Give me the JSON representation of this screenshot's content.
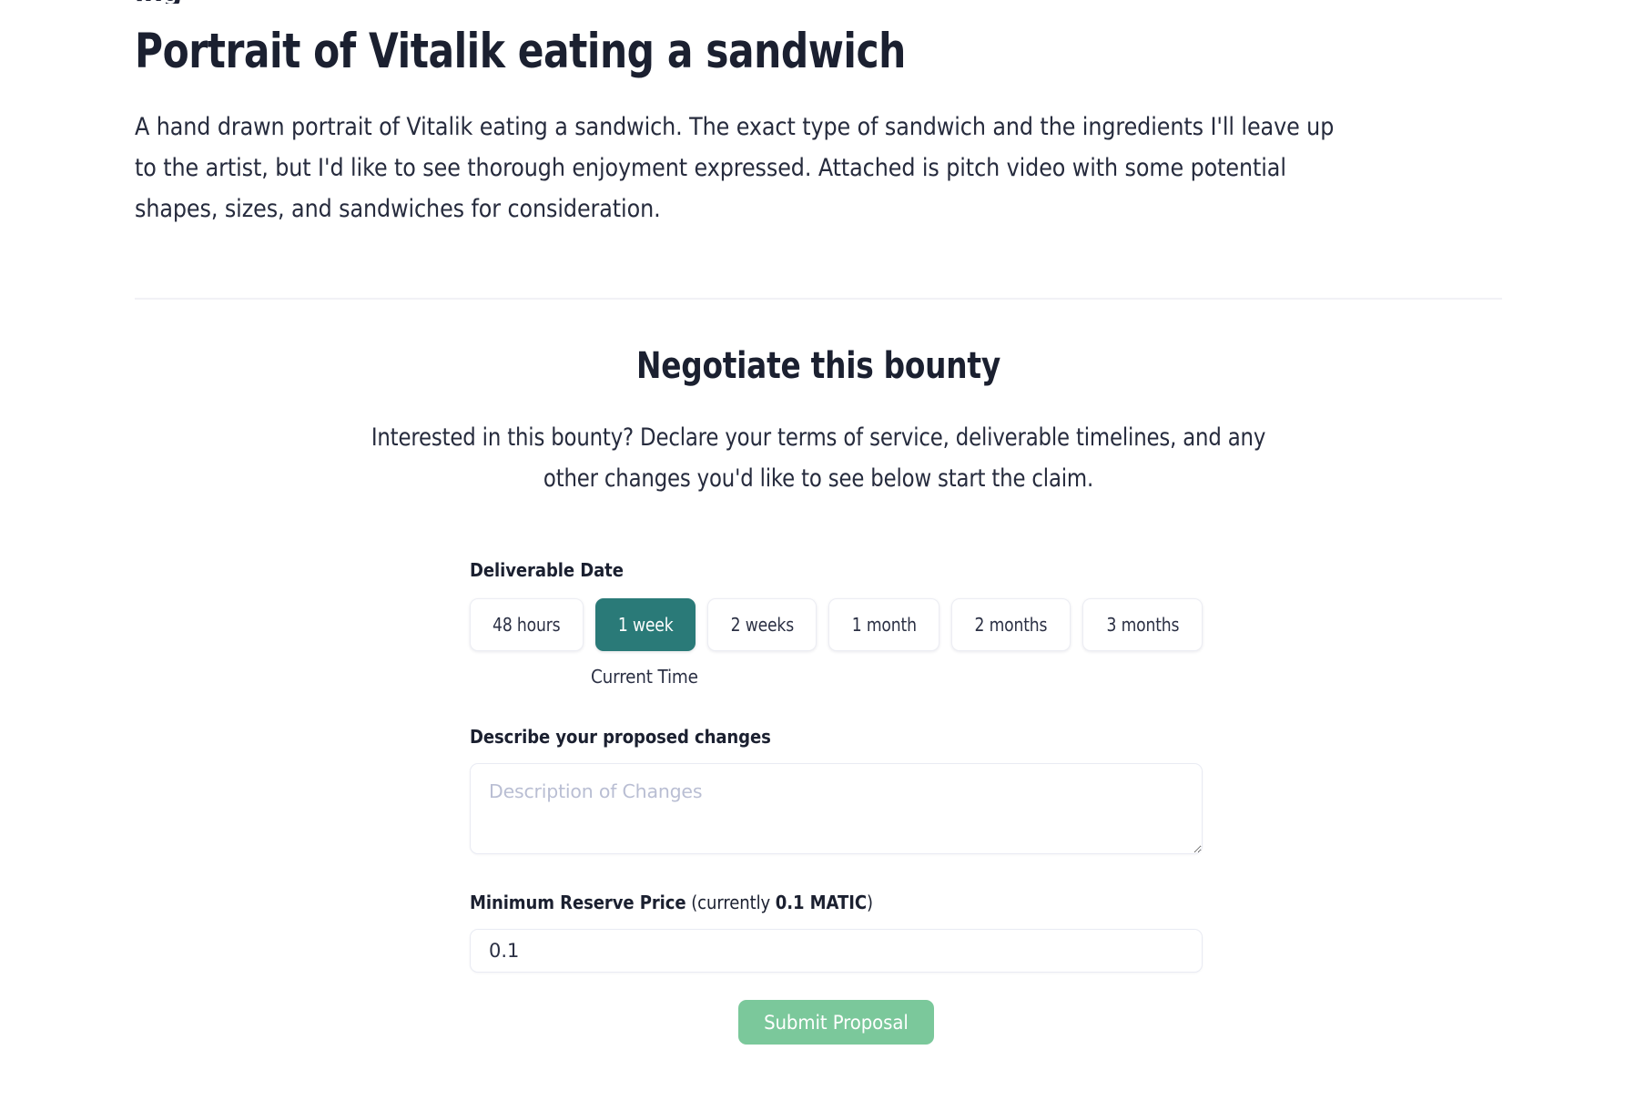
{
  "clipped_top_fragment": "ing",
  "bounty": {
    "title": "Portrait of Vitalik eating a sandwich",
    "description": "A hand drawn portrait of Vitalik eating a sandwich. The exact type of sandwich and the ingredients I'll leave up to the artist, but I'd like to see thorough enjoyment expressed. Attached is pitch video with some potential shapes, sizes, and sandwiches for consideration."
  },
  "negotiate": {
    "heading": "Negotiate this bounty",
    "subtitle": "Interested in this bounty? Declare your terms of service, deliverable timelines, and any other changes you'd like to see below start the claim."
  },
  "form": {
    "deliverable_date": {
      "label": "Deliverable Date",
      "options": [
        {
          "label": "48 hours",
          "selected": false
        },
        {
          "label": "1 week",
          "selected": true
        },
        {
          "label": "2 weeks",
          "selected": false
        },
        {
          "label": "1 month",
          "selected": false
        },
        {
          "label": "2 months",
          "selected": false
        },
        {
          "label": "3 months",
          "selected": false
        }
      ],
      "selected_value": "1 week",
      "helper_text": "Current Time"
    },
    "changes": {
      "label": "Describe your proposed changes",
      "placeholder": "Description of Changes",
      "value": ""
    },
    "reserve_price": {
      "label_main": "Minimum Reserve Price",
      "label_currently_prefix": " (currently ",
      "label_currently_value": "0.1 MATIC",
      "label_currently_suffix": ")",
      "value": "0.1"
    },
    "submit_label": "Submit Proposal"
  },
  "colors": {
    "text": "#1b2030",
    "body_text": "#262b3d",
    "selected_pill": "#2a7a78",
    "submit_green": "#7bc89b",
    "placeholder": "#b9bed3",
    "border": "#e9ebf3",
    "divider": "#f1f1f6",
    "background": "#ffffff"
  }
}
